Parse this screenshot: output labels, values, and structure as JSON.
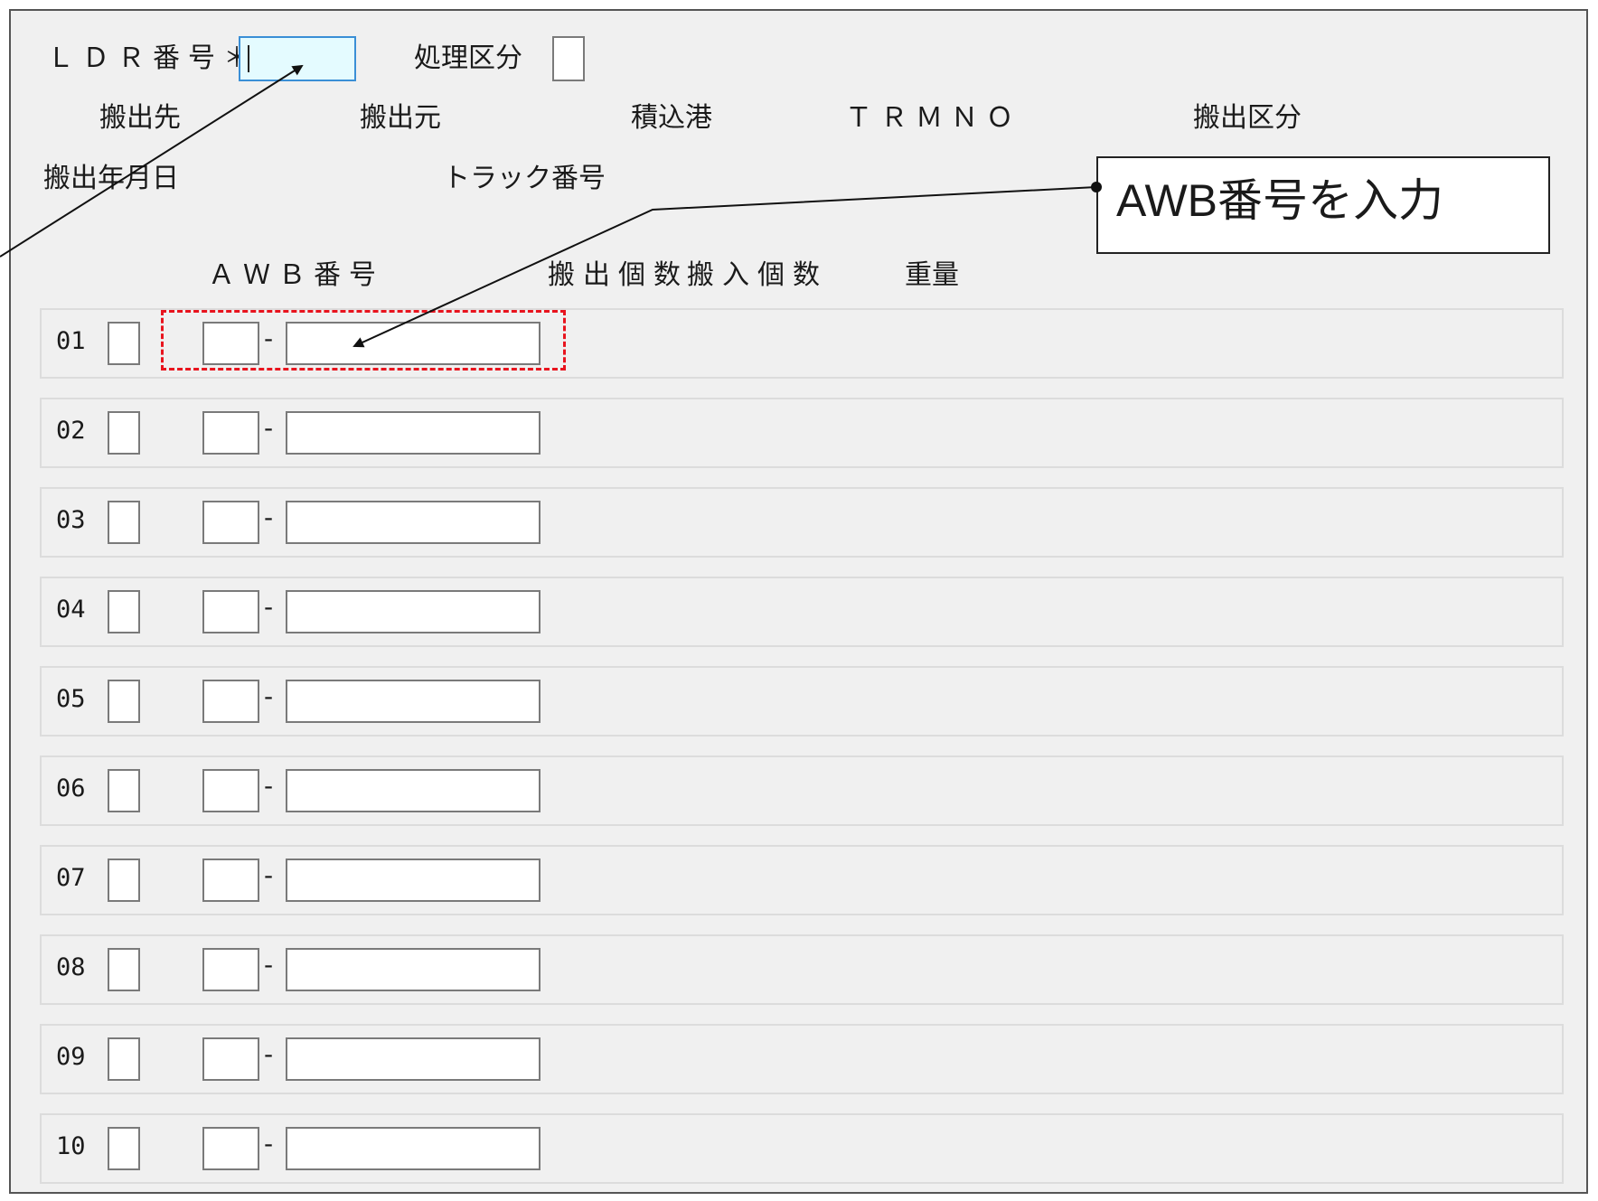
{
  "header": {
    "ldr_label": "ＬＤＲ番号＊",
    "shori_label": "処理区分",
    "row2": [
      "搬出先",
      "搬出元",
      "積込港",
      "ＴＲＭＮＯ",
      "搬出区分"
    ],
    "row3": [
      "搬出年月日",
      "トラック番号"
    ]
  },
  "columns": {
    "awb": "ＡＷＢ番号",
    "out_count": "搬出個数",
    "in_count": "搬入個数",
    "weight": "重量"
  },
  "rows": [
    {
      "num": "01"
    },
    {
      "num": "02"
    },
    {
      "num": "03"
    },
    {
      "num": "04"
    },
    {
      "num": "05"
    },
    {
      "num": "06"
    },
    {
      "num": "07"
    },
    {
      "num": "08"
    },
    {
      "num": "09"
    },
    {
      "num": "10"
    }
  ],
  "dash": "-",
  "callout": {
    "text": "AWB番号を入力"
  },
  "colors": {
    "highlight": "#e8141e",
    "focus_border": "#3a8fd6",
    "focus_fill": "#e4fbff"
  }
}
